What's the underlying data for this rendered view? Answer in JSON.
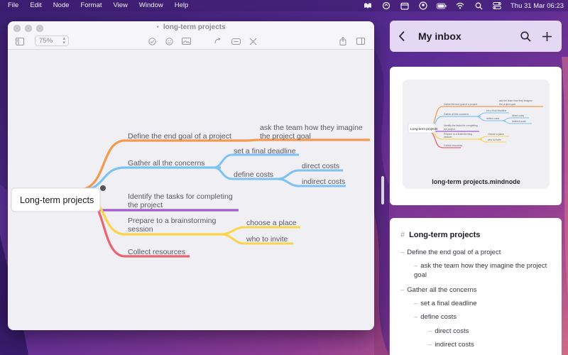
{
  "menubar": {
    "items": [
      "File",
      "Edit",
      "Node",
      "Format",
      "View",
      "Window",
      "Help"
    ],
    "clock": "Thu 31 Mar  06:23",
    "tray_icons": [
      "mindnode-icon",
      "sync-icon",
      "calendar-icon",
      "user-icon",
      "battery-icon",
      "wifi-icon",
      "search-icon",
      "control-center-icon"
    ]
  },
  "window": {
    "title": "long-term projects",
    "zoom": "75%",
    "toolbar_icons": [
      "outline-toggle-icon",
      "task-icon",
      "emoji-icon",
      "image-icon",
      "connect-icon",
      "note-icon",
      "focus-icon",
      "share-icon",
      "sidebar-icon"
    ]
  },
  "mindmap": {
    "root": "Long-term projects",
    "branches": [
      {
        "label": "Define the end goal of a project",
        "color": "#f39a4e",
        "children": [
          {
            "label": "ask the team how they imagine the project goal"
          }
        ]
      },
      {
        "label": "Gather all the concerns",
        "color": "#7cc3f2",
        "children": [
          {
            "label": "set a final deadline"
          },
          {
            "label": "define costs",
            "children": [
              {
                "label": "direct costs"
              },
              {
                "label": "indirect costs"
              }
            ]
          }
        ]
      },
      {
        "label": "Identify the tasks for completing the project",
        "color": "#a25bcb",
        "children": []
      },
      {
        "label": "Prepare to a brainstorming session",
        "color": "#fbd44c",
        "children": [
          {
            "label": "choose a place"
          },
          {
            "label": "who to invite"
          }
        ]
      },
      {
        "label": "Collect resources",
        "color": "#ec6370",
        "children": []
      }
    ]
  },
  "inbox": {
    "title": "My inbox",
    "file_name": "long-term projects.mindnode"
  },
  "outline": {
    "title": "Long-term projects",
    "lines": [
      "Define the end goal of a project",
      "ask the team how they imagine the project goal",
      "Gather all the concerns",
      "set a final deadline",
      "define costs",
      "direct costs",
      "indirect costs"
    ]
  }
}
